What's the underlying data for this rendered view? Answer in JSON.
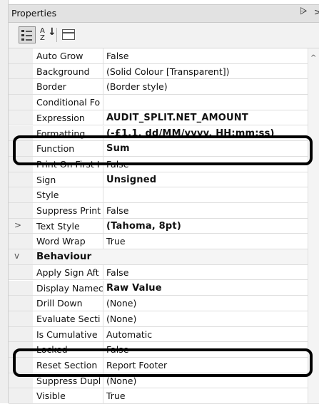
{
  "panel": {
    "title": "Properties",
    "pin_glyph": "⩥",
    "close_glyph": ">"
  },
  "toolbar": {
    "categorized_icon": "categorized-icon",
    "alphabetical": {
      "top": "A",
      "bottom": "Z",
      "arrow": "↓"
    },
    "property_pages_icon": "property-pages-icon"
  },
  "rows": [
    {
      "name": "Auto Grow",
      "value": "False",
      "bold": false
    },
    {
      "name": "Background",
      "value": "(Solid Colour [Transparent])",
      "bold": false
    },
    {
      "name": "Border",
      "value": "(Border style)",
      "bold": false
    },
    {
      "name": "Conditional Fo",
      "value": "",
      "bold": false
    },
    {
      "name": "Expression",
      "value": "AUDIT_SPLIT.NET_AMOUNT",
      "bold": true
    },
    {
      "name": "Formatting",
      "value": "(-£1.1, dd/MM/yyyy, HH:mm:ss)",
      "bold": true
    },
    {
      "name": "Function",
      "value": "Sum",
      "bold": true
    },
    {
      "name": "Print On First I",
      "value": "False",
      "bold": false
    },
    {
      "name": "Sign",
      "value": "Unsigned",
      "bold": true
    },
    {
      "name": "Style",
      "value": "",
      "bold": false
    },
    {
      "name": "Suppress Print",
      "value": "False",
      "bold": false
    },
    {
      "name": "Text Style",
      "value": "(Tahoma, 8pt)",
      "bold": true,
      "expander": ">"
    },
    {
      "name": "Word Wrap",
      "value": "True",
      "bold": false
    },
    {
      "name": "Behaviour",
      "value": "",
      "category": true,
      "expander": "v"
    },
    {
      "name": "Apply Sign Aft",
      "value": "False",
      "bold": false
    },
    {
      "name": "Display Namec",
      "value": "Raw Value",
      "bold": true
    },
    {
      "name": "Drill Down",
      "value": "(None)",
      "bold": false
    },
    {
      "name": "Evaluate Secti",
      "value": "(None)",
      "bold": false
    },
    {
      "name": "Is Cumulative",
      "value": "Automatic",
      "bold": false
    },
    {
      "name": "Locked",
      "value": "False",
      "bold": false
    },
    {
      "name": "Reset Section",
      "value": "Report Footer",
      "bold": false
    },
    {
      "name": "Suppress Dupl",
      "value": "(None)",
      "bold": false
    },
    {
      "name": "Visible",
      "value": "True",
      "bold": false
    }
  ],
  "scrollbar": {
    "up_glyph": "^"
  }
}
